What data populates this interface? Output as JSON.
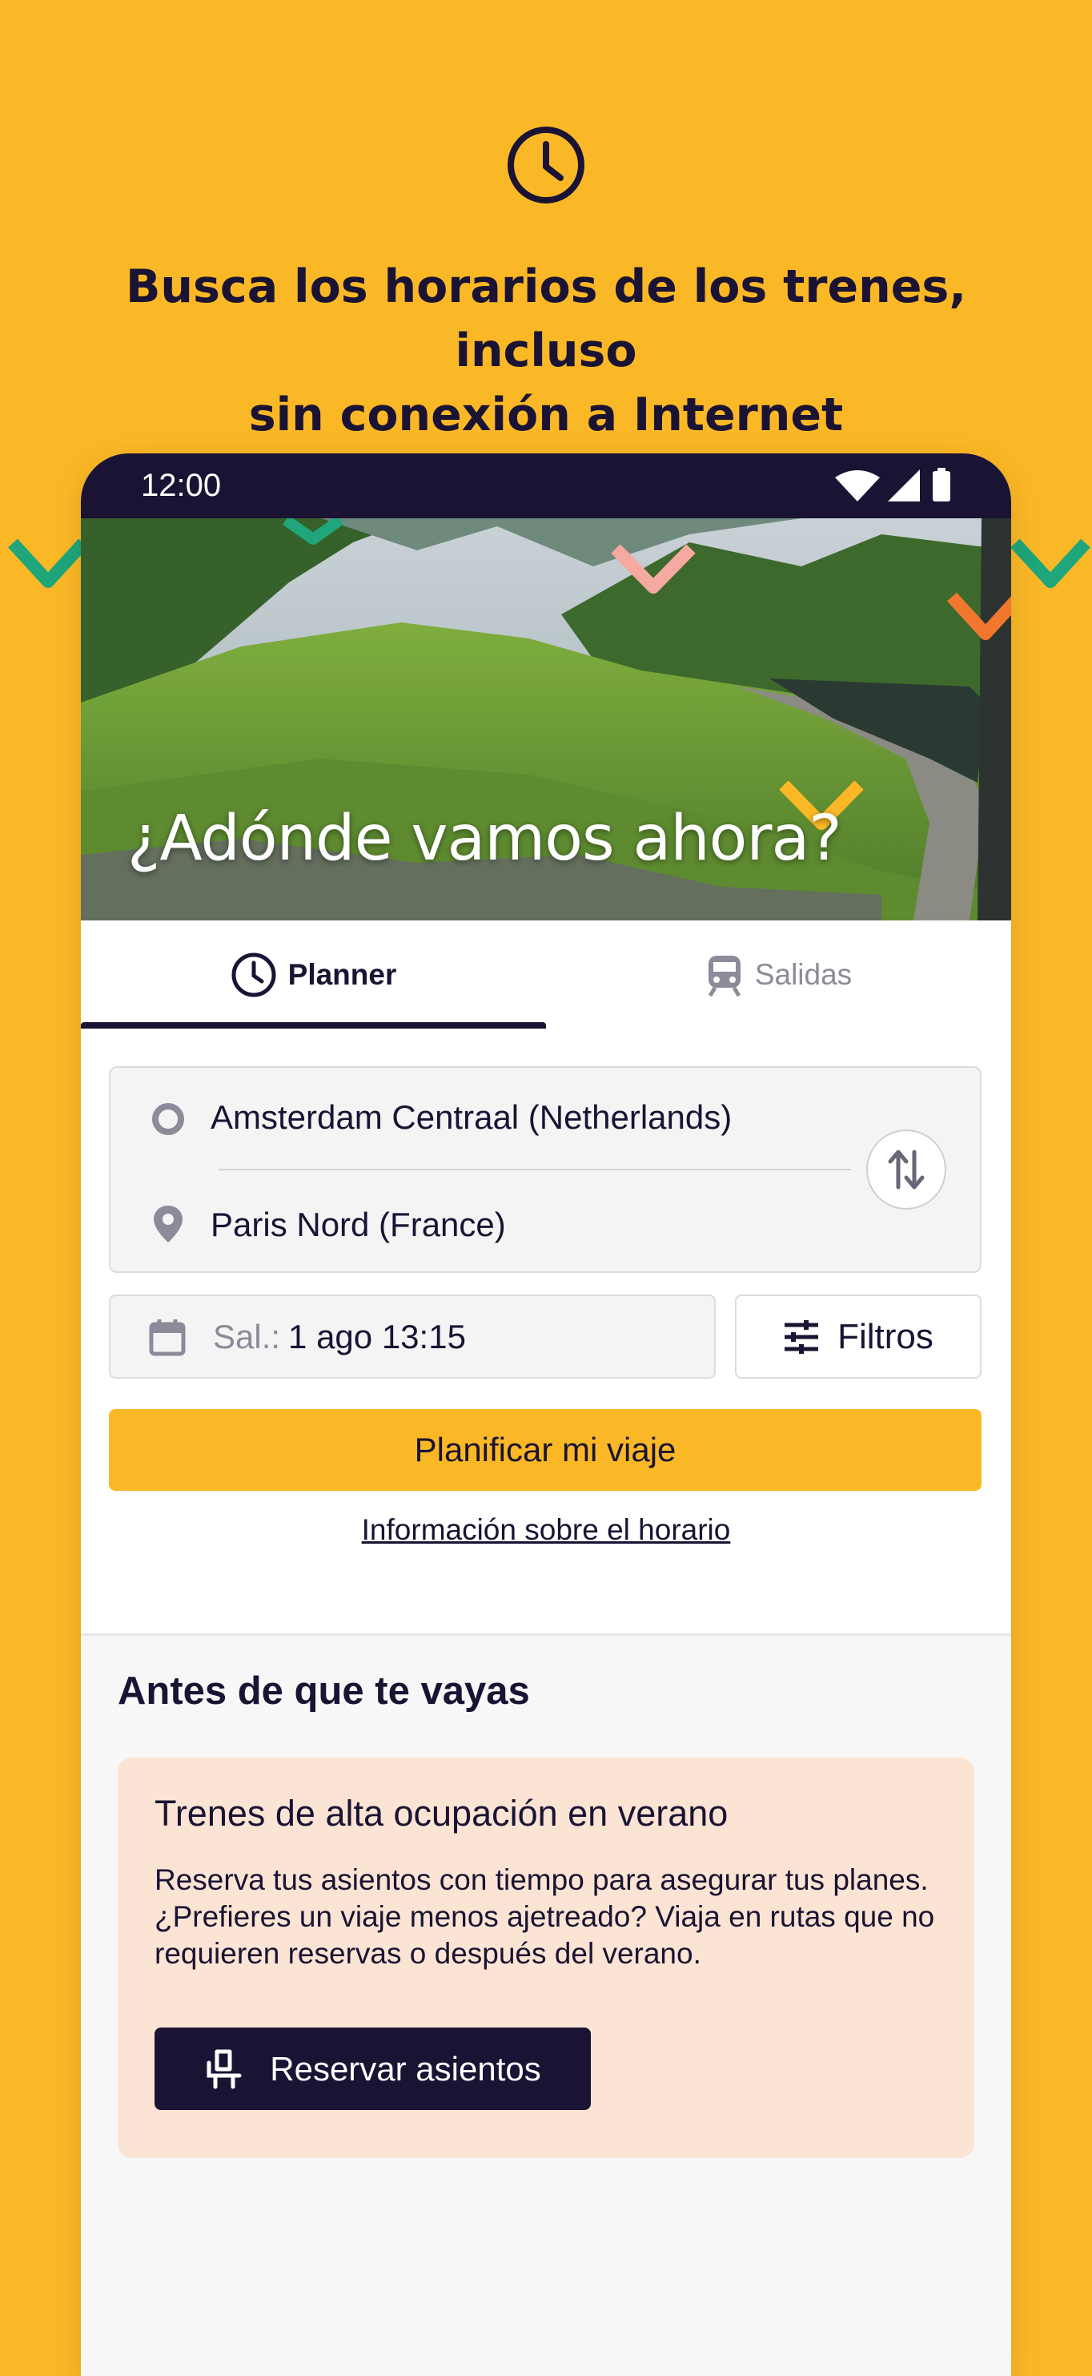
{
  "promo": {
    "icon": "clock-icon",
    "headline_line1": "Busca los horarios de los trenes, incluso",
    "headline_line2": "sin conexión a Internet"
  },
  "colors": {
    "background": "#FBB826",
    "brand_dark": "#1A1333",
    "accent_yellow": "#FBB826",
    "card_bg": "#FCE4D4",
    "deco_green": "#1FA67A",
    "deco_pink": "#F6A9A0",
    "deco_orange": "#F2772E"
  },
  "status_bar": {
    "time": "12:00",
    "icons": [
      "wifi-icon",
      "signal-icon",
      "battery-icon"
    ]
  },
  "hero": {
    "title": "¿Adónde vamos ahora?"
  },
  "tabs": [
    {
      "label": "Planner",
      "icon": "clock-icon",
      "active": true
    },
    {
      "label": "Salidas",
      "icon": "train-icon",
      "active": false
    }
  ],
  "planner": {
    "origin": "Amsterdam Centraal (Netherlands)",
    "destination": "Paris Nord (France)",
    "date_prefix": "Sal.:",
    "date_value": "1 ago 13:15",
    "filters_label": "Filtros",
    "plan_button": "Planificar mi viaje",
    "info_link": "Información sobre el horario"
  },
  "before_you_go": {
    "title": "Antes de que te vayas",
    "card": {
      "title": "Trenes de alta ocupación en verano",
      "body": "Reserva tus asientos con tiempo para asegurar tus planes. ¿Prefieres un viaje menos ajetreado? Viaja en rutas que no requieren reservas o después del verano.",
      "button": "Reservar asientos"
    }
  }
}
